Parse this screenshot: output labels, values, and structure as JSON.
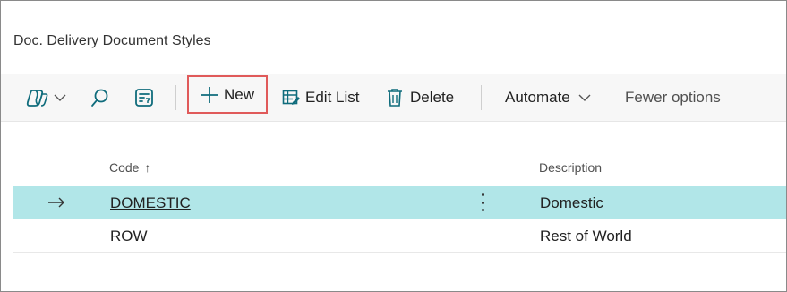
{
  "page": {
    "title": "Doc. Delivery Document Styles"
  },
  "toolbar": {
    "new_label": "New",
    "edit_list_label": "Edit List",
    "delete_label": "Delete",
    "automate_label": "Automate",
    "fewer_options_label": "Fewer options"
  },
  "columns": {
    "code": "Code",
    "code_sort_indicator": "↑",
    "description": "Description"
  },
  "rows": [
    {
      "code": "DOMESTIC",
      "description": "Domestic",
      "selected": true
    },
    {
      "code": "ROW",
      "description": "Rest of World",
      "selected": false
    }
  ],
  "colors": {
    "selected_row": "#b1e6e8",
    "highlight_border": "#e05a5a",
    "accent_icon": "#0f6c7c"
  }
}
